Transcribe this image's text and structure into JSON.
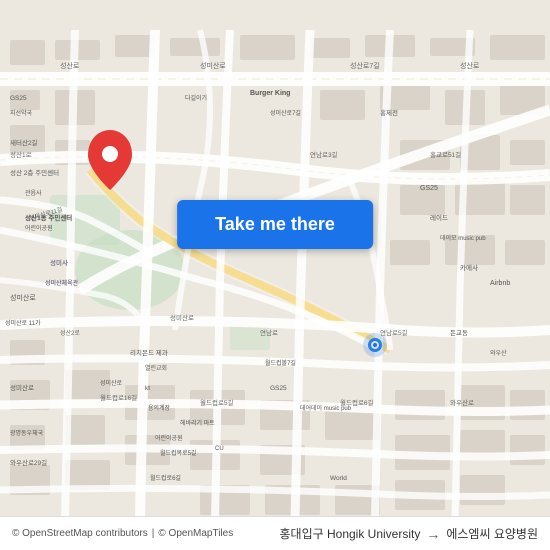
{
  "map": {
    "background_color": "#ece8e0",
    "center": "Seoul, Mapo-gu area",
    "zoom": 15
  },
  "button": {
    "label": "Take me there"
  },
  "route": {
    "origin": "홍대입구 Hongik University",
    "destination": "에스엠씨 요양병원",
    "arrow": "→"
  },
  "copyright": {
    "text1": "© OpenStreetMap contributors",
    "separator": " | ",
    "text2": "© OpenMapTiles"
  },
  "pins": {
    "start_color": "#1a73e8",
    "end_color": "#e53935"
  }
}
